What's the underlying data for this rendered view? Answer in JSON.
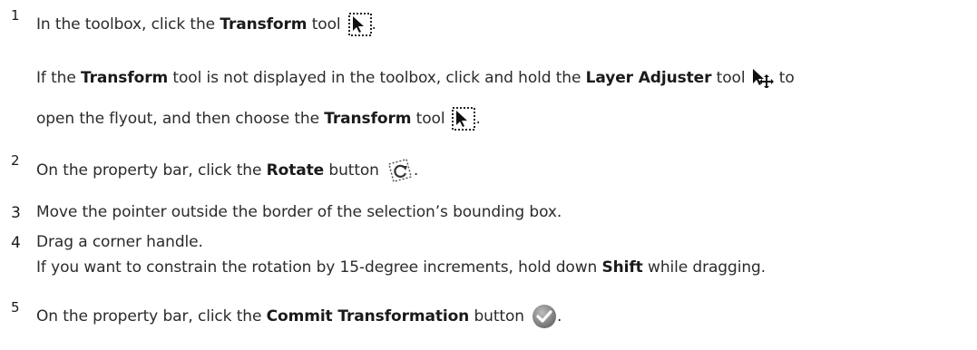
{
  "steps": [
    {
      "number": "1",
      "pre": "In the toolbox, click the ",
      "bold": "Transform",
      "post": " tool",
      "icon": "transform-tool-icon",
      "end": "."
    },
    {
      "pre_a": "If the ",
      "bold_a": "Transform",
      "mid_a": " tool is not displayed in the toolbox, click and hold the ",
      "bold_b": "Layer Adjuster",
      "mid_b": " tool",
      "icon_b": "layer-adjuster-tool-icon",
      "end_b": " to",
      "line2_pre": "open the flyout, and then choose the ",
      "line2_bold": "Transform",
      "line2_post": " tool",
      "line2_icon": "transform-tool-icon",
      "line2_end": "."
    },
    {
      "number": "2",
      "pre": "On the property bar, click the ",
      "bold": "Rotate",
      "post": " button",
      "icon": "rotate-icon",
      "end": "."
    },
    {
      "number": "3",
      "text": "Move the pointer outside the border of the selection’s bounding box."
    },
    {
      "number": "4",
      "text": "Drag a corner handle.",
      "sub_pre": "If you want to constrain the rotation by 15-degree increments, hold down ",
      "sub_bold": "Shift",
      "sub_post": " while dragging."
    },
    {
      "number": "5",
      "pre": "On the property bar, click the ",
      "bold": "Commit Transformation",
      "post": " button",
      "icon": "commit-checkmark-icon",
      "end": "."
    }
  ]
}
